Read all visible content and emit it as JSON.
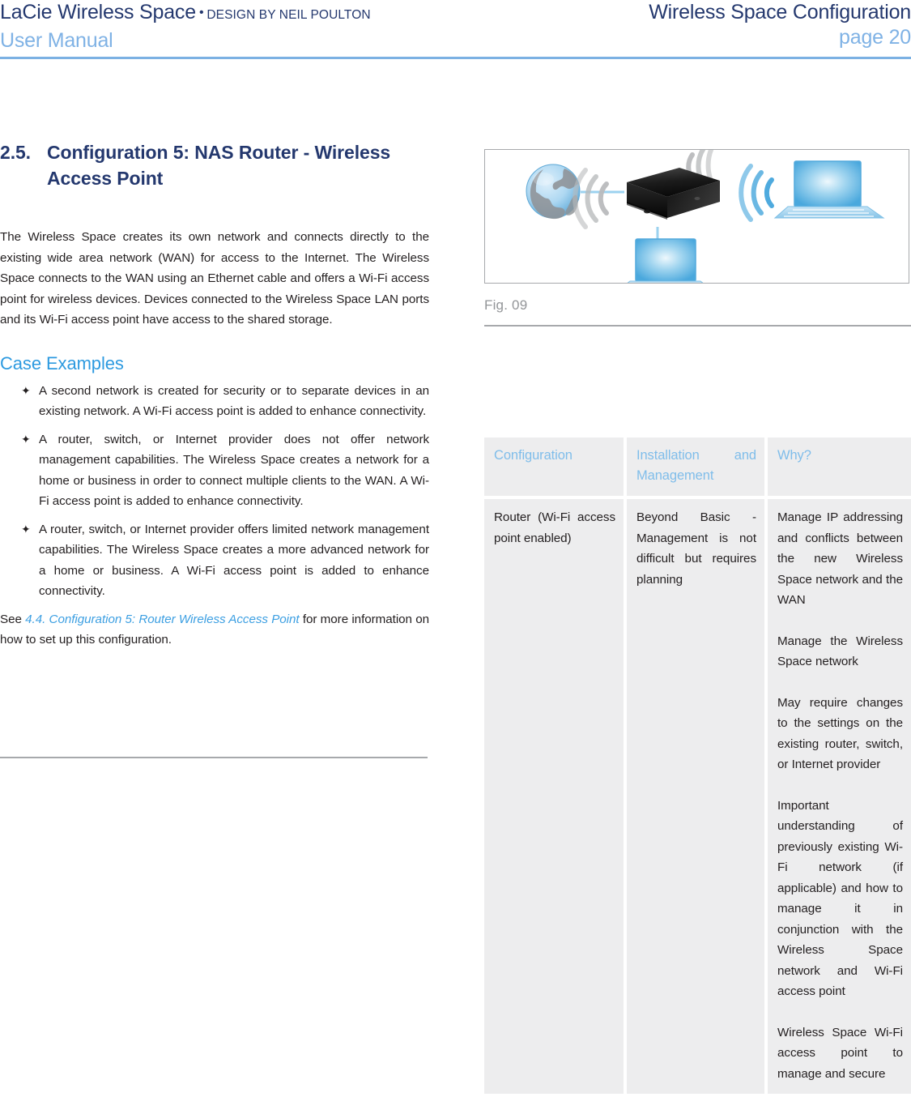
{
  "header": {
    "brand": "LaCie Wireless Space",
    "separator": "•",
    "design_credit": "DESIGN BY NEIL POULTON",
    "manual_label": "User Manual",
    "chapter_title": "Wireless Space Configuration",
    "page_label": "page 20",
    "rule_color": "#7cb1e3",
    "navy": "#24386e",
    "light_blue": "#7fb2e5"
  },
  "section": {
    "number": "2.5.",
    "title": "Configuration 5: NAS Router - Wireless Access Point",
    "intro": "The Wireless Space creates its own network and connects directly to the existing wide area network (WAN) for access to the Internet. The Wireless Space connects to the WAN using an Ethernet cable and offers a Wi-Fi access point for wireless devices. Devices connected to the Wireless Space LAN ports and its Wi-Fi access point have access to the shared storage.",
    "case_examples_heading": "Case Examples",
    "case_examples_color": "#2d9ae0",
    "bullet_glyph": "✦",
    "bullets": [
      "A second network is created for security or to separate devices in an existing network. A Wi-Fi access point is added to enhance connectivity.",
      "A router, switch, or Internet provider does not offer network management capabilities. The Wireless Space creates a network for a home or business in order to connect multiple clients to the WAN. A Wi-Fi access point is added to enhance connectivity.",
      "A router, switch, or Internet provider offers limited network management capabilities. The Wireless Space creates a more advanced network for a home or business. A Wi-Fi access point is added to enhance connectivity."
    ],
    "see_prefix": "See ",
    "see_link": "4.4. Configuration 5: Router Wireless Access Point",
    "see_suffix": " for more information on how to set up this configuration.",
    "link_color": "#3c9fe2"
  },
  "figure": {
    "caption": "Fig. 09",
    "caption_color": "#939598",
    "border_color": "#a7a9ac",
    "alt": "Network diagram: globe (Internet) connected by Ethernet to a black Wireless Space NAS device, which broadcasts Wi-Fi to two laptops",
    "nodes": [
      {
        "name": "globe-icon",
        "label": "Internet / WAN"
      },
      {
        "name": "nas-device-icon",
        "label": "Wireless Space"
      },
      {
        "name": "laptop-icon-wired",
        "label": "LAN client"
      },
      {
        "name": "laptop-icon-wireless",
        "label": "Wi-Fi client"
      }
    ]
  },
  "table": {
    "header_text_color": "#7fbdea",
    "cell_bg": "#ededee",
    "columns": [
      "Configuration",
      "Installation and Management",
      "Why?"
    ],
    "rows": [
      {
        "configuration": [
          "Router (Wi-Fi access point enabled)"
        ],
        "installation": [
          "Beyond Basic - Management is not difficult but requires planning"
        ],
        "why": [
          "Manage IP addressing and conflicts between the new Wireless Space network and the WAN",
          "Manage the Wireless Space network",
          "May require changes to the settings on the existing router, switch, or Internet provider",
          "Important understanding of previously existing Wi-Fi network (if applicable) and how to manage it in conjunction with the Wireless Space network and Wi-Fi access point",
          "Wireless Space Wi-Fi access point to manage and secure"
        ]
      }
    ]
  }
}
